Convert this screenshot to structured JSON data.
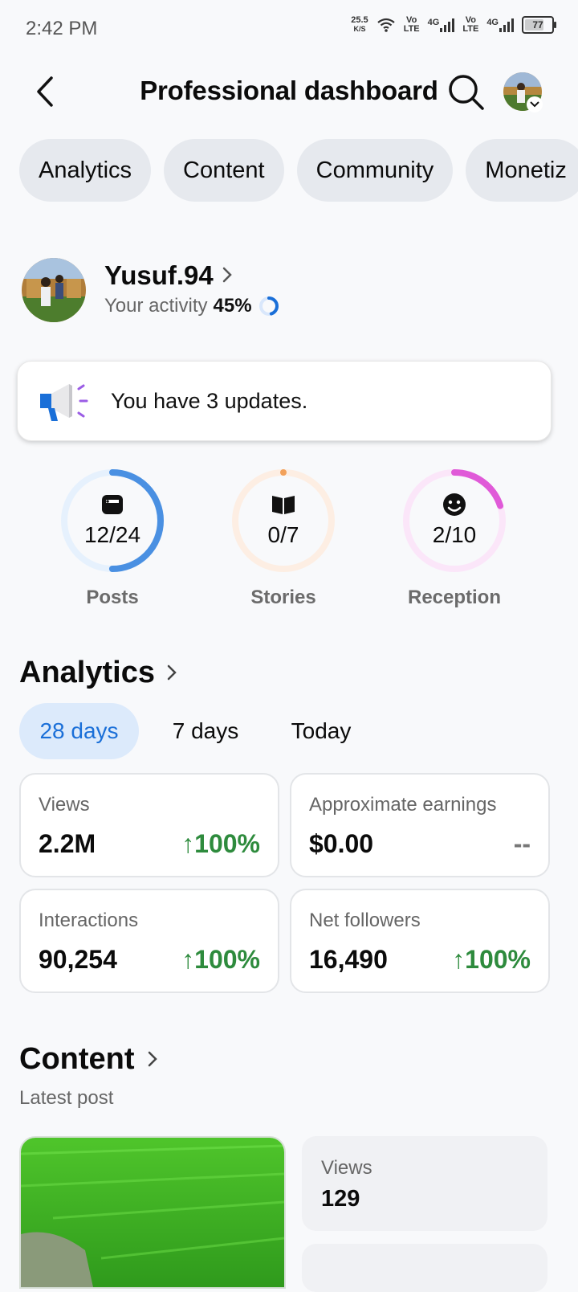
{
  "status_bar": {
    "time": "2:42 PM",
    "net_speed_value": "25.5",
    "net_speed_unit": "K/S",
    "volte1_top": "Vo",
    "volte1_bottom": "LTE",
    "net1": "4G",
    "volte2_top": "Vo",
    "volte2_bottom": "LTE",
    "net2": "4G",
    "battery": "77",
    "battery_level": 0.77
  },
  "header": {
    "title": "Professional dashboard"
  },
  "tabs": [
    {
      "label": "Analytics"
    },
    {
      "label": "Content"
    },
    {
      "label": "Community"
    },
    {
      "label": "Monetiz"
    }
  ],
  "profile": {
    "name": "Yusuf.94",
    "activity_label": "Your activity",
    "activity_value": "45%",
    "activity_fraction": 0.45
  },
  "updates": {
    "text": "You have 3 updates."
  },
  "rings": [
    {
      "label": "Posts",
      "value": "12/24",
      "fraction": 0.5,
      "color": "#4a90e2",
      "track": "#e6f1fd",
      "icon": "posts-icon"
    },
    {
      "label": "Stories",
      "value": "0/7",
      "fraction": 0.0,
      "color": "#f2a15a",
      "track": "#fdeee3",
      "icon": "stories-book-icon"
    },
    {
      "label": "Reception",
      "value": "2/10",
      "fraction": 0.2,
      "color": "#e05ad8",
      "track": "#fbe6f9",
      "icon": "reception-smiley-icon"
    }
  ],
  "analytics": {
    "title": "Analytics",
    "periods": [
      "28 days",
      "7 days",
      "Today"
    ],
    "selected_period": "28 days",
    "cards": [
      {
        "label": "Views",
        "value": "2.2M",
        "delta": "100%"
      },
      {
        "label": "Approximate earnings",
        "value": "$0.00",
        "delta": "--"
      },
      {
        "label": "Interactions",
        "value": "90,254",
        "delta": "100%"
      },
      {
        "label": "Net followers",
        "value": "16,490",
        "delta": "100%"
      }
    ]
  },
  "content": {
    "title": "Content",
    "subtitle": "Latest post",
    "post_stats": [
      {
        "label": "Views",
        "value": "129"
      }
    ]
  },
  "colors": {
    "accent_blue": "#1a6fd8",
    "positive_green": "#2e8b3d",
    "pill_bg": "#e6e9ee",
    "selected_pill_bg": "#dceafb"
  }
}
